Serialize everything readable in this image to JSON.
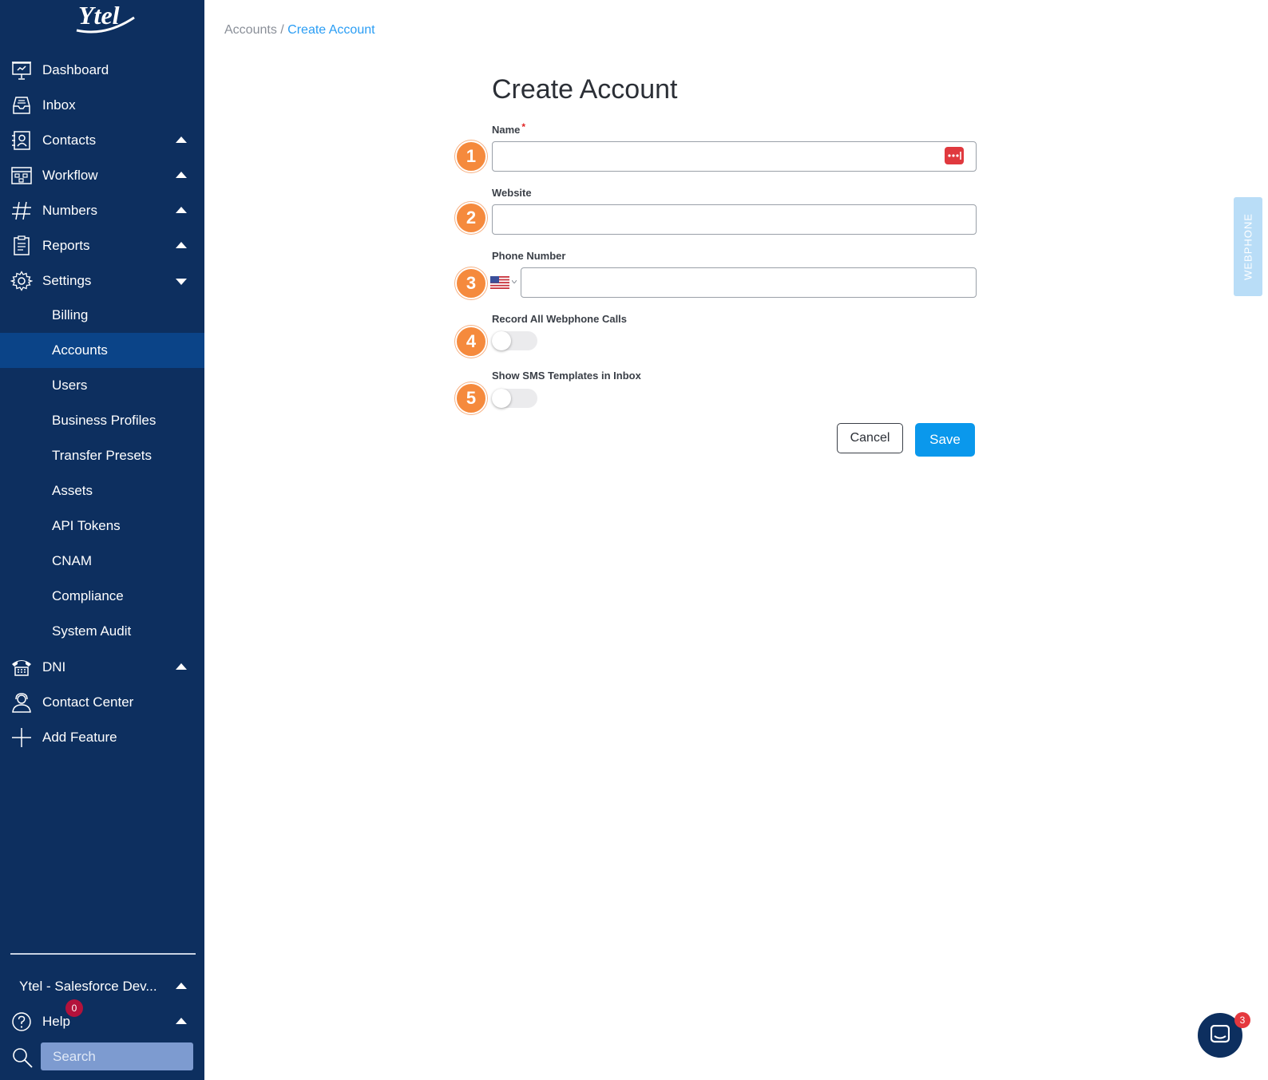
{
  "brand": {
    "logo_text": "Ytel"
  },
  "sidebar": {
    "items": [
      {
        "label": "Dashboard"
      },
      {
        "label": "Inbox"
      },
      {
        "label": "Contacts"
      },
      {
        "label": "Workflow"
      },
      {
        "label": "Numbers"
      },
      {
        "label": "Reports"
      },
      {
        "label": "Settings"
      }
    ],
    "settings_sub": [
      {
        "label": "Billing"
      },
      {
        "label": "Accounts"
      },
      {
        "label": "Users"
      },
      {
        "label": "Business Profiles"
      },
      {
        "label": "Transfer Presets"
      },
      {
        "label": "Assets"
      },
      {
        "label": "API Tokens"
      },
      {
        "label": "CNAM"
      },
      {
        "label": "Compliance"
      },
      {
        "label": "System Audit"
      }
    ],
    "lower_items": [
      {
        "label": "DNI"
      },
      {
        "label": "Contact Center"
      },
      {
        "label": "Add Feature"
      }
    ],
    "account_switcher": "Ytel - Salesforce Dev...",
    "help_label": "Help",
    "help_badge": "0",
    "search_placeholder": "Search"
  },
  "breadcrumb": {
    "parent": "Accounts",
    "separator": " / ",
    "current": "Create Account"
  },
  "form": {
    "title": "Create Account",
    "name_label": "Name",
    "name_required_mark": "*",
    "website_label": "Website",
    "phone_label": "Phone Number",
    "record_label": "Record All Webphone Calls",
    "record_on": false,
    "sms_label": "Show SMS Templates in Inbox",
    "sms_on": false,
    "cancel_label": "Cancel",
    "save_label": "Save",
    "step_badges": [
      "1",
      "2",
      "3",
      "4",
      "5"
    ]
  },
  "webphone_tab": "WEBPHONE",
  "chat": {
    "badge": "3"
  },
  "colors": {
    "sidebar": "#0d2f5f",
    "active": "#0b4488",
    "accent": "#0a98ec",
    "badge_orange": "#f58a3d"
  }
}
